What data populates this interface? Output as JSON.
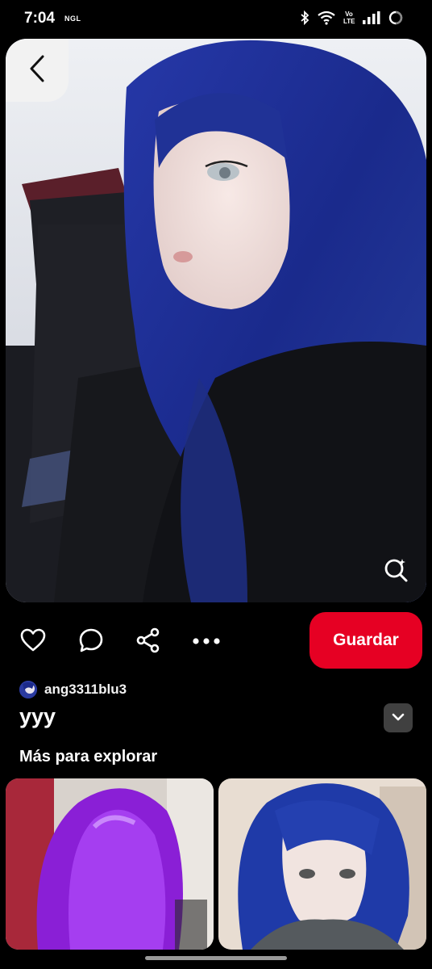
{
  "status_bar": {
    "time": "7:04",
    "carrier_badge": "NGL",
    "icons": [
      "bluetooth-icon",
      "wifi-icon",
      "volte-icon",
      "signal-icon",
      "battery-icon"
    ],
    "volte_label": "Vo LTE"
  },
  "pin": {
    "image_icon_back": "chevron-left-icon",
    "visual_search_icon": "visual-search-icon",
    "title": "yyy",
    "creator": {
      "name": "ang3311blu3"
    }
  },
  "actions": {
    "icons": [
      "heart-icon",
      "comment-icon",
      "share-icon",
      "more-icon"
    ],
    "save_label": "Guardar",
    "save_color": "#e60023"
  },
  "explore": {
    "heading": "Más para explorar"
  }
}
